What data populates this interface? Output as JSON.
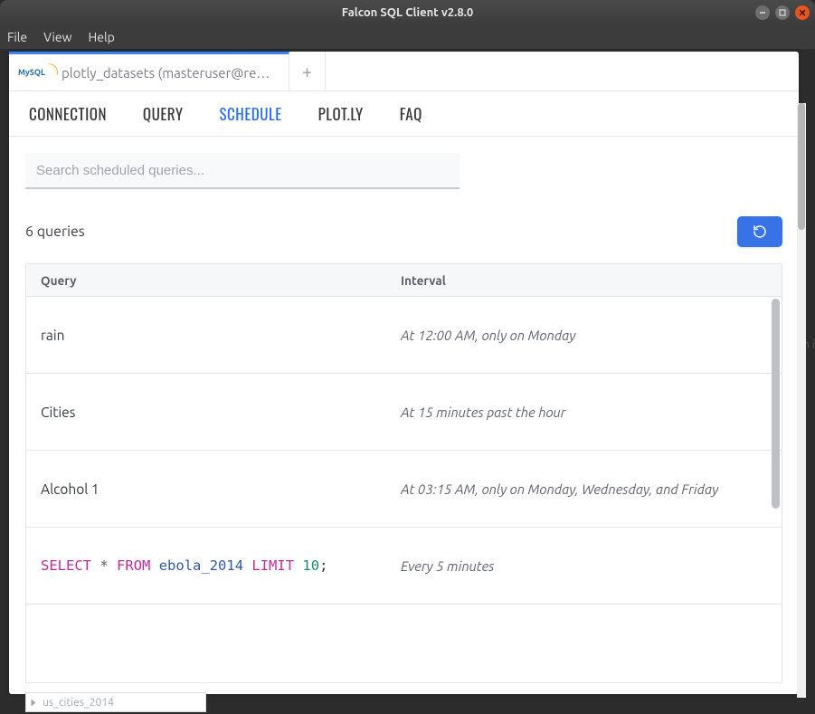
{
  "window": {
    "title": "Falcon SQL Client v2.8.0"
  },
  "menu": {
    "file": "File",
    "view": "View",
    "help": "Help"
  },
  "connTab": {
    "logo": "MySQL",
    "label": "plotly_datasets (masteruser@read…"
  },
  "addTab": "+",
  "nav": {
    "connection": "CONNECTION",
    "query": "QUERY",
    "schedule": "SCHEDULE",
    "plotly": "PLOT.LY",
    "faq": "FAQ"
  },
  "search": {
    "placeholder": "Search scheduled queries..."
  },
  "countLabel": "6 queries",
  "columns": {
    "query": "Query",
    "interval": "Interval"
  },
  "rows": [
    {
      "name": "rain",
      "interval": "At 12:00 AM, only on Monday"
    },
    {
      "name": "Cities",
      "interval": "At 15 minutes past the hour"
    },
    {
      "name": "Alcohol 1",
      "interval": "At 03:15 AM, only on Monday, Wednesday, and Friday"
    },
    {
      "name": "",
      "interval": "Every 5 minutes",
      "sql": {
        "select": "SELECT",
        "star": "*",
        "from": "FROM",
        "table": "ebola_2014",
        "limit": "LIMIT",
        "n": "10",
        "semi": ";"
      }
    }
  ],
  "bgItem": "us_cities_2014",
  "bgRight": "n i"
}
